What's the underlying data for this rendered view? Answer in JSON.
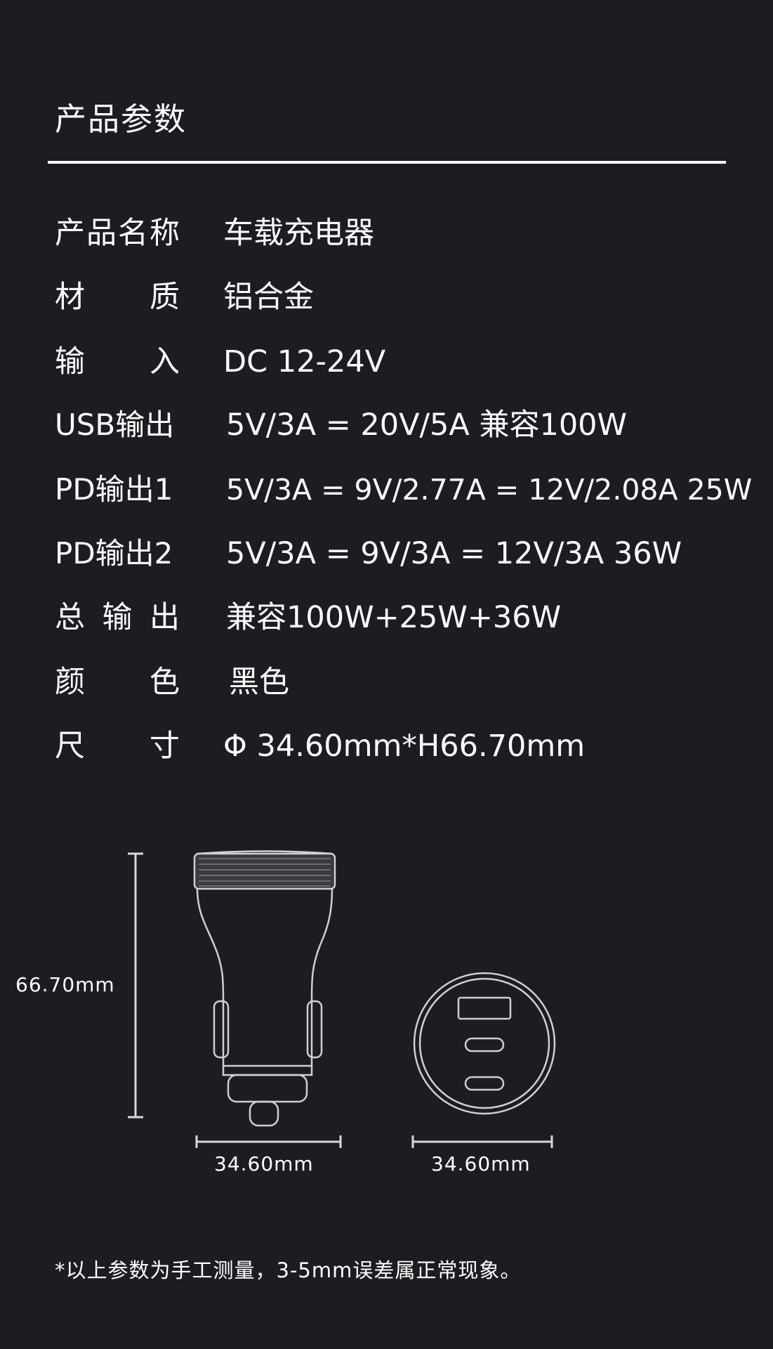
{
  "title": "产品参数",
  "specs": [
    {
      "label_chars": [
        "产",
        "品",
        "名",
        "称"
      ],
      "value": "车载充电器"
    },
    {
      "label_chars": [
        "材",
        "质"
      ],
      "value": "铝合金"
    },
    {
      "label_chars": [
        "输",
        "入"
      ],
      "value": "DC 12-24V"
    },
    {
      "label_chars": [
        "USB输出"
      ],
      "value": "5V/3A = 20V/5A  兼容100W"
    },
    {
      "label_chars": [
        "PD输出1"
      ],
      "value": "5V/3A = 9V/2.77A = 12V/2.08A 25W"
    },
    {
      "label_chars": [
        "PD输出2"
      ],
      "value": "5V/3A = 9V/3A = 12V/3A  36W"
    },
    {
      "label_chars": [
        "总",
        "输",
        "出"
      ],
      "value": "兼容100W+25W+36W"
    },
    {
      "label_chars": [
        "颜",
        "色"
      ],
      "value": "黑色"
    },
    {
      "label_chars": [
        "尺",
        "寸"
      ],
      "value": "Φ 34.60mm*H66.70mm"
    }
  ],
  "diagram": {
    "height_label": "66.70mm",
    "side_width_label": "34.60mm",
    "top_width_label": "34.60mm"
  },
  "footnote": "*以上参数为手工测量，3-5mm误差属正常现象。",
  "colors": {
    "background": "#1c1d22",
    "text": "#ffffff",
    "line": "#d9d9d9"
  }
}
